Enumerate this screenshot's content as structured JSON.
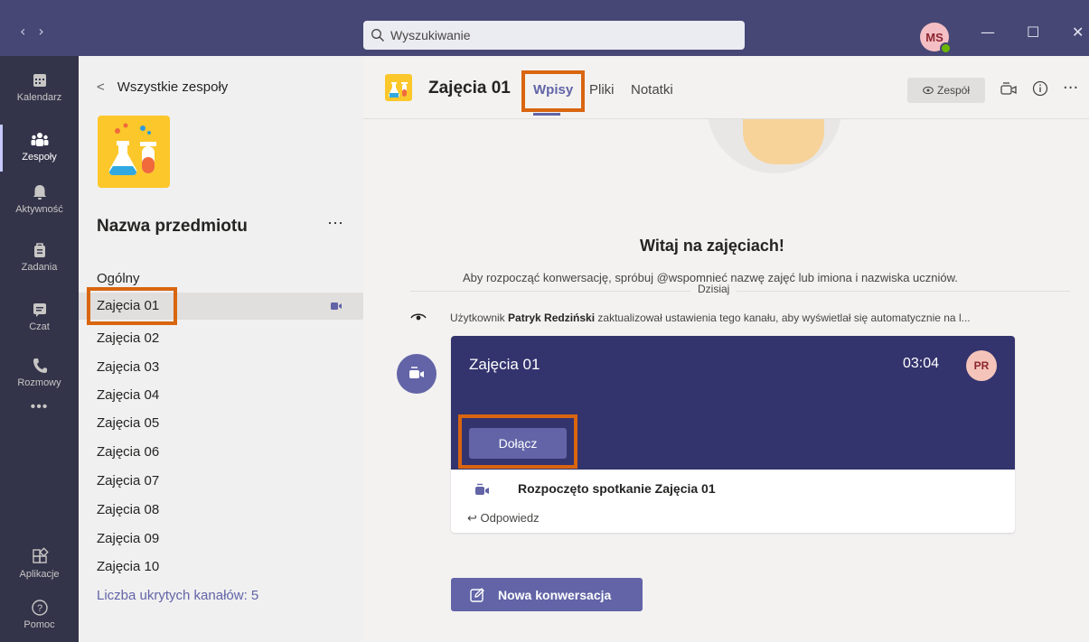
{
  "titlebar": {
    "back_arrow": "‹",
    "forward_arrow": "›",
    "search_placeholder": "Wyszukiwanie",
    "user_initials": "MS",
    "minimize": "—",
    "maximize": "☐",
    "close": "✕"
  },
  "appbar": {
    "items": [
      {
        "label": "Kalendarz",
        "icon": "calendar-icon"
      },
      {
        "label": "Zespoły",
        "icon": "teams-icon"
      },
      {
        "label": "Aktywność",
        "icon": "bell-icon"
      },
      {
        "label": "Zadania",
        "icon": "assignments-icon"
      },
      {
        "label": "Czat",
        "icon": "chat-icon"
      },
      {
        "label": "Rozmowy",
        "icon": "phone-icon"
      }
    ],
    "more": "•••",
    "apps_label": "Aplikacje",
    "help_label": "Pomoc"
  },
  "leftpanel": {
    "back_label": "Wszystkie zespoły",
    "team_name": "Nazwa przedmiotu",
    "more": "···",
    "channels": [
      "Ogólny",
      "Zajęcia 01",
      "Zajęcia 02",
      "Zajęcia 03",
      "Zajęcia 04",
      "Zajęcia 05",
      "Zajęcia 06",
      "Zajęcia 07",
      "Zajęcia 08",
      "Zajęcia 09",
      "Zajęcia 10"
    ],
    "hidden_channels": "Liczba ukrytych kanałów: 5"
  },
  "header": {
    "channel_title": "Zajęcia 01",
    "tabs": [
      "Wpisy",
      "Pliki",
      "Notatki"
    ],
    "team_button": "Zespół",
    "more": "···"
  },
  "feed": {
    "welcome_title": "Witaj na zajęciach!",
    "welcome_sub": "Aby rozpocząć konwersację, spróbuj @wspomnieć nazwę zajęć lub imiona i nazwiska uczniów.",
    "today": "Dzisiaj",
    "update_prefix": "Użytkownik ",
    "update_user": "Patryk Redziński",
    "update_suffix": " zaktualizował ustawienia tego kanału, aby wyświetlał się automatycznie na l...",
    "card_title": "Zajęcia 01",
    "card_time": "03:04",
    "card_avatar": "PR",
    "join_button": "Dołącz",
    "started": "Rozpoczęto spotkanie Zajęcia 01",
    "reply": "Odpowiedz",
    "new_conversation": "Nowa konwersacja"
  },
  "colors": {
    "titlebar": "#464775",
    "appbar": "#33344a",
    "accent": "#6264a7",
    "meeting_card": "#33336e",
    "highlight": "#d9650f"
  }
}
